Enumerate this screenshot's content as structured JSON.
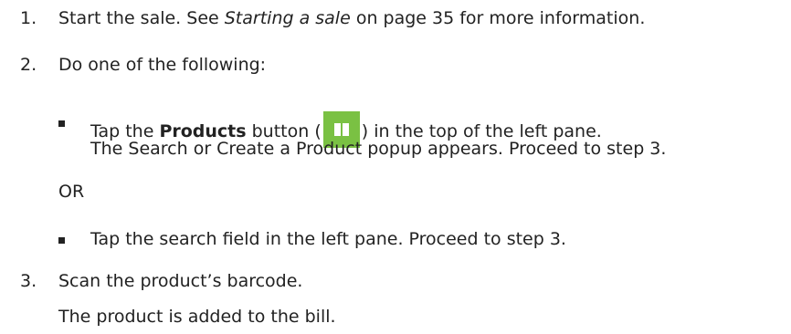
{
  "steps": [
    {
      "number": "1.",
      "text_before": "Start the sale. See ",
      "link_text": "Starting a sale",
      "text_after": " on page 35 for more information."
    },
    {
      "number": "2.",
      "text": "Do one of the following:"
    },
    {
      "number": "3.",
      "text": "Scan the product’s barcode."
    }
  ],
  "option_a": {
    "before": "Tap the ",
    "bold": "Products",
    "mid": " button (",
    "after": ") in the top of the left pane.",
    "line2": "The Search or Create a Product popup appears. Proceed to step 3.",
    "icon": "products-icon",
    "icon_color": "#7ac143"
  },
  "or_text": "OR",
  "option_b": "Tap the search field in the left pane. Proceed to step 3.",
  "result": "The product is added to the bill."
}
